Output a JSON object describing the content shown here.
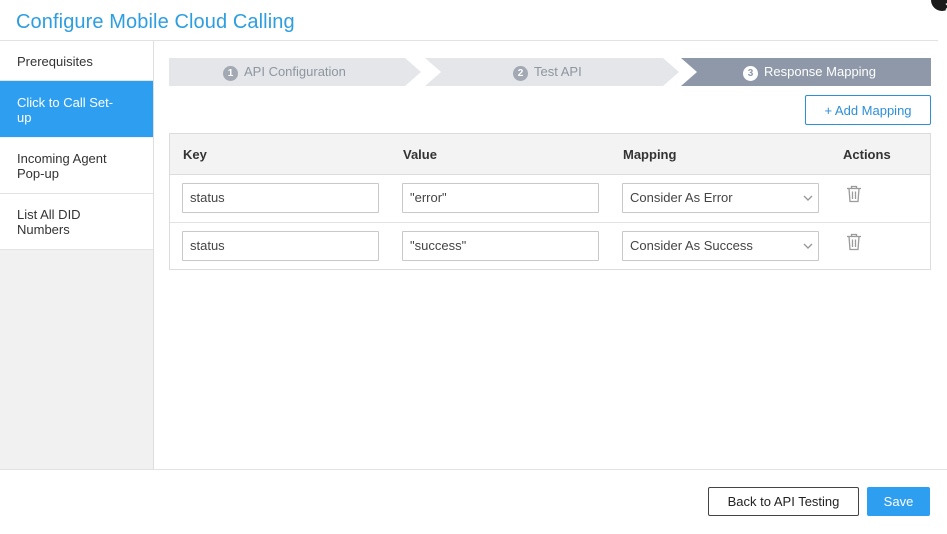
{
  "modal": {
    "title": "Configure Mobile Cloud Calling",
    "close_icon": "close-icon"
  },
  "sidebar": {
    "items": [
      {
        "lines": [
          "Prerequisites"
        ],
        "active": false
      },
      {
        "lines": [
          "Click to Call Set-",
          "up"
        ],
        "active": true
      },
      {
        "lines": [
          "Incoming Agent",
          "Pop-up"
        ],
        "active": false
      },
      {
        "lines": [
          "List All DID",
          "Numbers"
        ],
        "active": false
      }
    ]
  },
  "stepper": {
    "steps": [
      {
        "number": "1",
        "label": "API Configuration",
        "active": false
      },
      {
        "number": "2",
        "label": "Test API",
        "active": false
      },
      {
        "number": "3",
        "label": "Response Mapping",
        "active": true
      }
    ]
  },
  "toolbar": {
    "add_mapping_label": "+ Add Mapping"
  },
  "table": {
    "headers": {
      "key": "Key",
      "value": "Value",
      "mapping": "Mapping",
      "actions": "Actions"
    },
    "rows": [
      {
        "key": "status",
        "value": "\"error\"",
        "mapping": "Consider As Error",
        "action_icon": "trash-icon"
      },
      {
        "key": "status",
        "value": "\"success\"",
        "mapping": "Consider As Success",
        "action_icon": "trash-icon"
      }
    ]
  },
  "footer": {
    "back_label": "Back to API Testing",
    "save_label": "Save"
  },
  "colors": {
    "accent": "#2e9ff0",
    "title": "#2d9ee0",
    "step_inactive": "#e4e6e9",
    "step_active": "#8e98a8"
  }
}
